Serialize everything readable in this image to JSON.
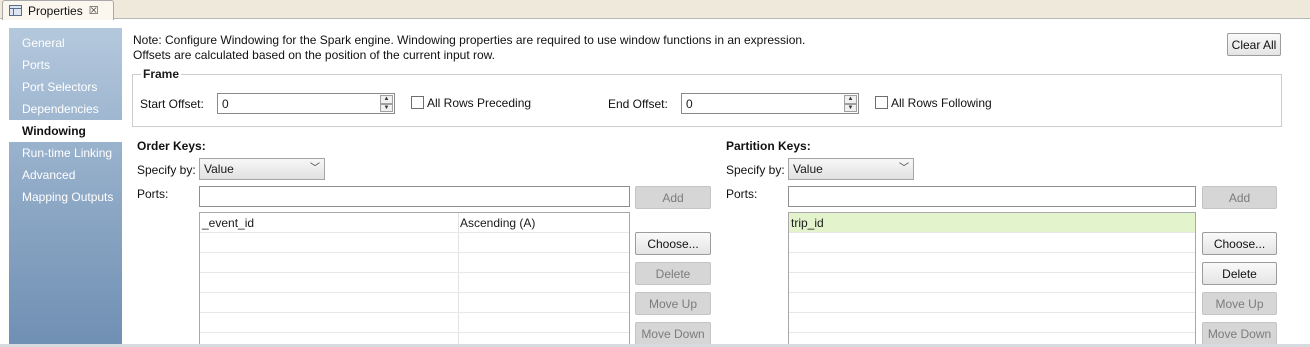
{
  "tab": {
    "label": "Properties",
    "close_glyph": "☒",
    "icon": "properties-icon"
  },
  "nav": {
    "items": [
      "General",
      "Ports",
      "Port Selectors",
      "Dependencies",
      "Windowing",
      "Run-time Linking",
      "Advanced",
      "Mapping Outputs"
    ],
    "active": "Windowing"
  },
  "note": {
    "line1": "Note: Configure Windowing for the Spark engine. Windowing properties are required to use window functions in an expression.",
    "line2": "Offsets are calculated based on the position of the current input row."
  },
  "clear_all_label": "Clear All",
  "frame": {
    "title": "Frame",
    "start_offset_label": "Start Offset:",
    "start_offset_value": "0",
    "all_rows_preceding_label": "All Rows Preceding",
    "all_rows_preceding_checked": false,
    "end_offset_label": "End Offset:",
    "end_offset_value": "0",
    "all_rows_following_label": "All Rows Following",
    "all_rows_following_checked": false
  },
  "order_keys": {
    "title": "Order Keys:",
    "specify_label": "Specify by:",
    "specify_value": "Value",
    "ports_label": "Ports:",
    "ports_value": "",
    "rows": [
      {
        "port": "_event_id",
        "order": "Ascending (A)"
      }
    ],
    "buttons": {
      "add": "Add",
      "choose": "Choose...",
      "delete": "Delete",
      "move_up": "Move Up",
      "move_down": "Move Down"
    }
  },
  "partition_keys": {
    "title": "Partition Keys:",
    "specify_label": "Specify by:",
    "specify_value": "Value",
    "ports_label": "Ports:",
    "ports_value": "",
    "rows": [
      {
        "port": "trip_id"
      }
    ],
    "buttons": {
      "add": "Add",
      "choose": "Choose...",
      "delete": "Delete",
      "move_up": "Move Up",
      "move_down": "Move Down"
    }
  },
  "colors": {
    "nav_gradient_top": "#b4c8dd",
    "nav_gradient_bottom": "#6f8fb3",
    "selected_row": "#e3f3cc",
    "tabstrip": "#efe9dc"
  }
}
